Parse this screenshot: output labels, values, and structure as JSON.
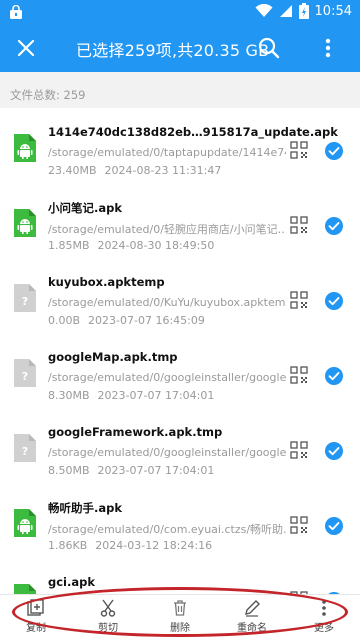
{
  "status_bar": {
    "time": "10:54"
  },
  "app_bar": {
    "title": "已选择259项,共20.35 GB"
  },
  "file_count": {
    "label": "文件总数:",
    "value": "259"
  },
  "files": [
    {
      "name": "1414e740dc138d82eb…915817a_update.apk",
      "path": "/storage/emulated/0/taptapupdate/1414e74…",
      "size": "23.40MB",
      "date": "2024-08-23 11:31:47",
      "type": "android",
      "checked": true
    },
    {
      "name": "小问笔记.apk",
      "path": "/storage/emulated/0/轻腕应用商店/小问笔记…",
      "size": "1.85MB",
      "date": "2024-08-30 18:49:50",
      "type": "android",
      "checked": true
    },
    {
      "name": "kuyubox.apktemp",
      "path": "/storage/emulated/0/KuYu/kuyubox.apktemp",
      "size": "0.00B",
      "date": "2023-07-07 16:45:09",
      "type": "unknown",
      "checked": true
    },
    {
      "name": "googleMap.apk.tmp",
      "path": "/storage/emulated/0/googleinstaller/google…",
      "size": "8.30MB",
      "date": "2023-07-07 17:04:01",
      "type": "unknown",
      "checked": true
    },
    {
      "name": "googleFramework.apk.tmp",
      "path": "/storage/emulated/0/googleinstaller/googleF…",
      "size": "8.50MB",
      "date": "2023-07-07 17:04:01",
      "type": "unknown",
      "checked": true
    },
    {
      "name": "畅听助手.apk",
      "path": "/storage/emulated/0/com.eyuai.ctzs/畅听助…",
      "size": "1.86KB",
      "date": "2024-03-12 18:24:16",
      "type": "android",
      "checked": true
    },
    {
      "name": "gci.apk",
      "path": "",
      "size": "",
      "date": "",
      "type": "android",
      "checked": true
    }
  ],
  "toolbar": {
    "copy": "复制",
    "cut": "剪切",
    "delete": "删除",
    "rename": "重命名",
    "more": "更多"
  },
  "colors": {
    "primary": "#2196F3",
    "android_green": "#3DBB3F",
    "unknown_gray": "#D0D0D0",
    "annotation_red": "#C4252A"
  }
}
